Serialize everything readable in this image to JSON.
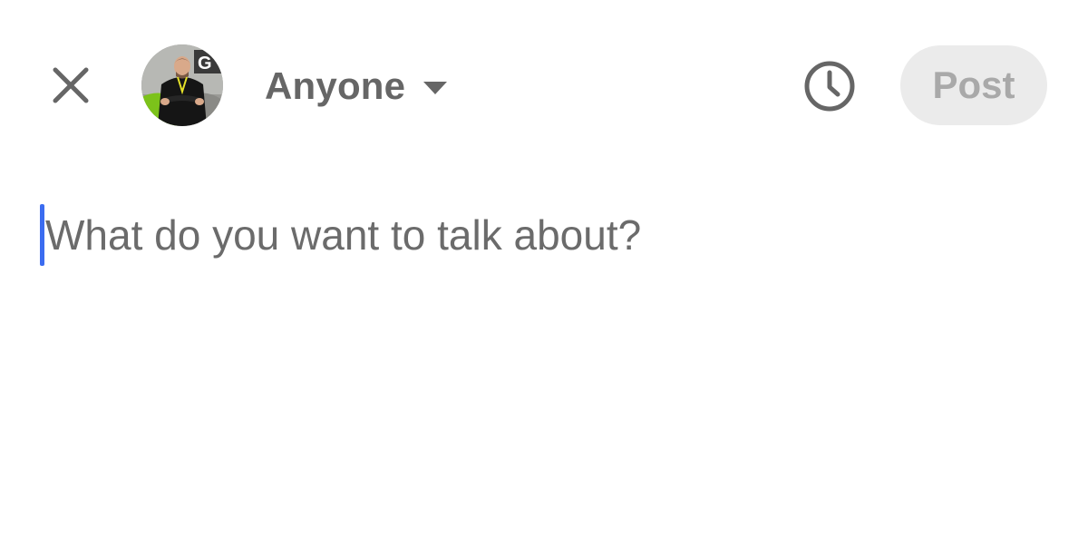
{
  "header": {
    "close_icon": "close-icon",
    "avatar_icon": "profile-avatar",
    "audience_label": "Anyone",
    "audience_caret_icon": "caret-down-icon",
    "schedule_icon": "clock-icon",
    "post_label": "Post",
    "post_enabled": false
  },
  "composer": {
    "placeholder": "What do you want to talk about?",
    "value": ""
  },
  "colors": {
    "icon_gray": "#666666",
    "post_bg_disabled": "#ebebeb",
    "post_text_disabled": "#a9a9a9",
    "caret": "#3b6cf0",
    "placeholder": "#6b6b6b"
  }
}
